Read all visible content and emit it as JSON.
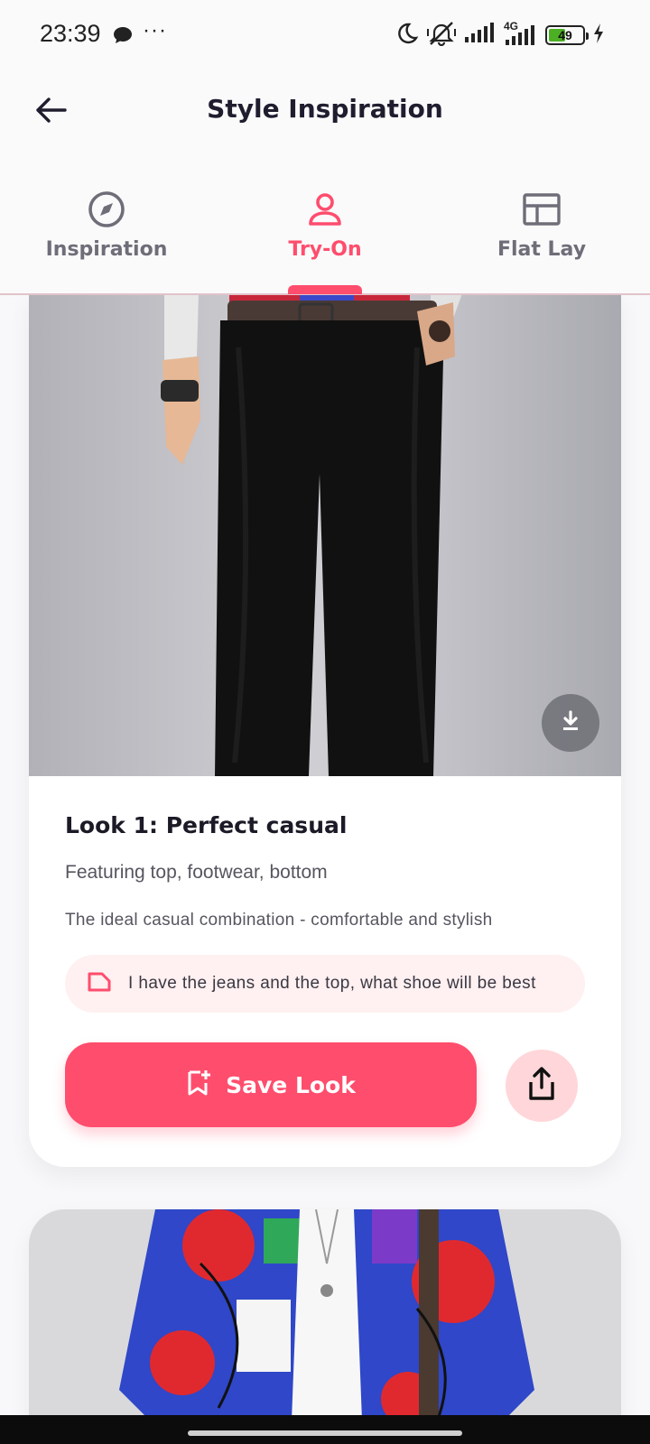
{
  "status_bar": {
    "time": "23:39",
    "dots": "···",
    "network_label": "4G",
    "battery_level": "49",
    "battery_fraction": 0.49
  },
  "header": {
    "title": "Style Inspiration",
    "back_icon": "arrow-left-icon"
  },
  "tabs": [
    {
      "label": "Inspiration",
      "icon": "compass-icon",
      "active": false
    },
    {
      "label": "Try-On",
      "icon": "person-icon",
      "active": true
    },
    {
      "label": "Flat Lay",
      "icon": "layout-icon",
      "active": false
    }
  ],
  "looks": [
    {
      "title": "Look 1: Perfect casual",
      "featuring": "Featuring top, footwear, bottom",
      "description": "The ideal casual combination - comfortable and stylish",
      "query": "I have the jeans and the top, what shoe will be best",
      "save_label": "Save Look"
    }
  ],
  "colors": {
    "accent": "#ff4d6d",
    "accent_soft": "#ffd6d9",
    "pill_bg": "#fff0f1",
    "tab_inactive": "#6f6d78",
    "title_text": "#1f1d2e"
  }
}
